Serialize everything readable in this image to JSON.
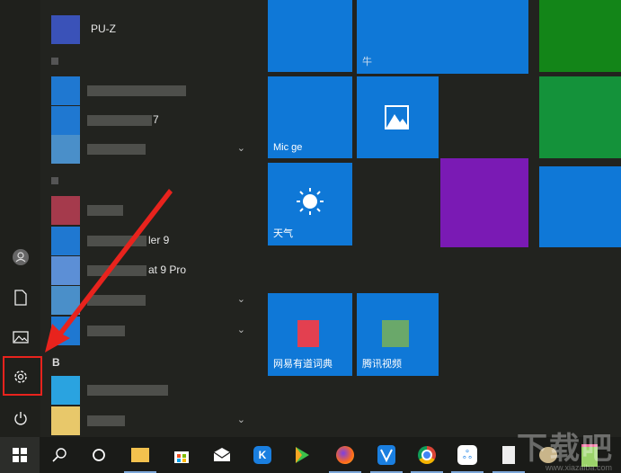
{
  "rail": {
    "items": [
      {
        "name": "user"
      },
      {
        "name": "documents"
      },
      {
        "name": "pictures"
      },
      {
        "name": "settings"
      },
      {
        "name": "power"
      }
    ]
  },
  "app_list": {
    "items_text": [
      "PU-Z",
      "7",
      "ler 9",
      "at 9 Pro"
    ],
    "header_b": "B"
  },
  "tiles": {
    "edge_label": "Mic        ge",
    "weather_label": "天气",
    "youdao_label": "网易有道词典",
    "tencent_label": "腾讯视频",
    "wide_label": "牛"
  },
  "annotation": {
    "color": "#e8231d"
  },
  "taskbar": {
    "items": [
      "start",
      "search",
      "cortana",
      "file-explorer",
      "store",
      "mail",
      "kugou",
      "video-player",
      "firefox",
      "tencent-security",
      "chrome",
      "baidu-netdisk",
      "file",
      "paint",
      "notepad"
    ]
  },
  "watermark": {
    "text": "下载吧",
    "sub": "www.xiazaiba.com"
  }
}
